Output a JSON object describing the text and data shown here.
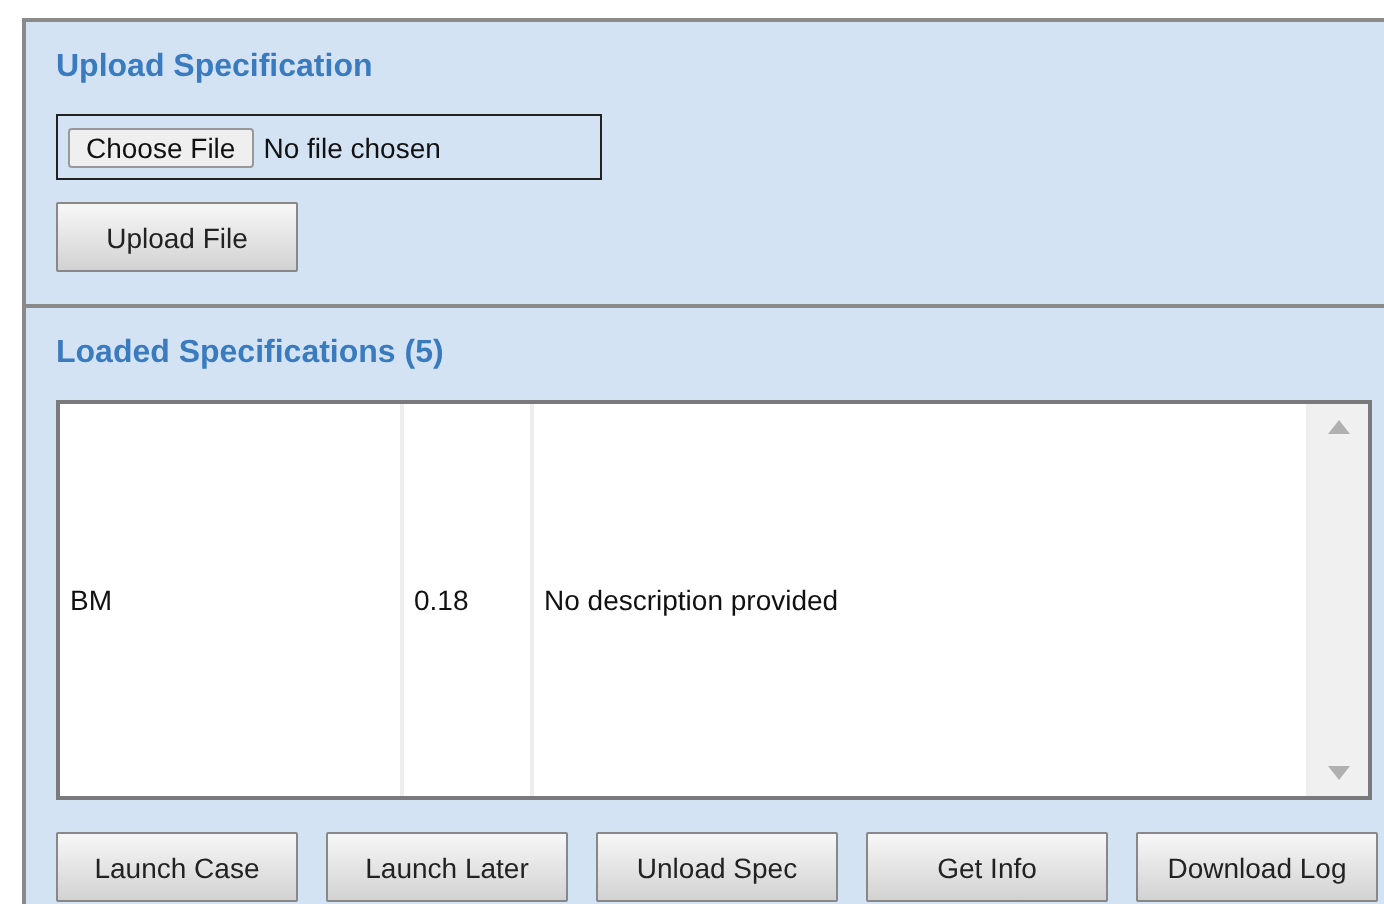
{
  "upload": {
    "title": "Upload Specification",
    "file_button": "Choose File",
    "file_status": "No file chosen",
    "upload_button": "Upload File"
  },
  "loaded": {
    "title": "Loaded Specifications (5)",
    "rows": [
      {
        "cells": [
          "BM",
          "0.18",
          "No description provided"
        ]
      }
    ],
    "buttons": [
      "Launch Case",
      "Launch Later",
      "Unload Spec",
      "Get Info",
      "Download Log"
    ]
  }
}
